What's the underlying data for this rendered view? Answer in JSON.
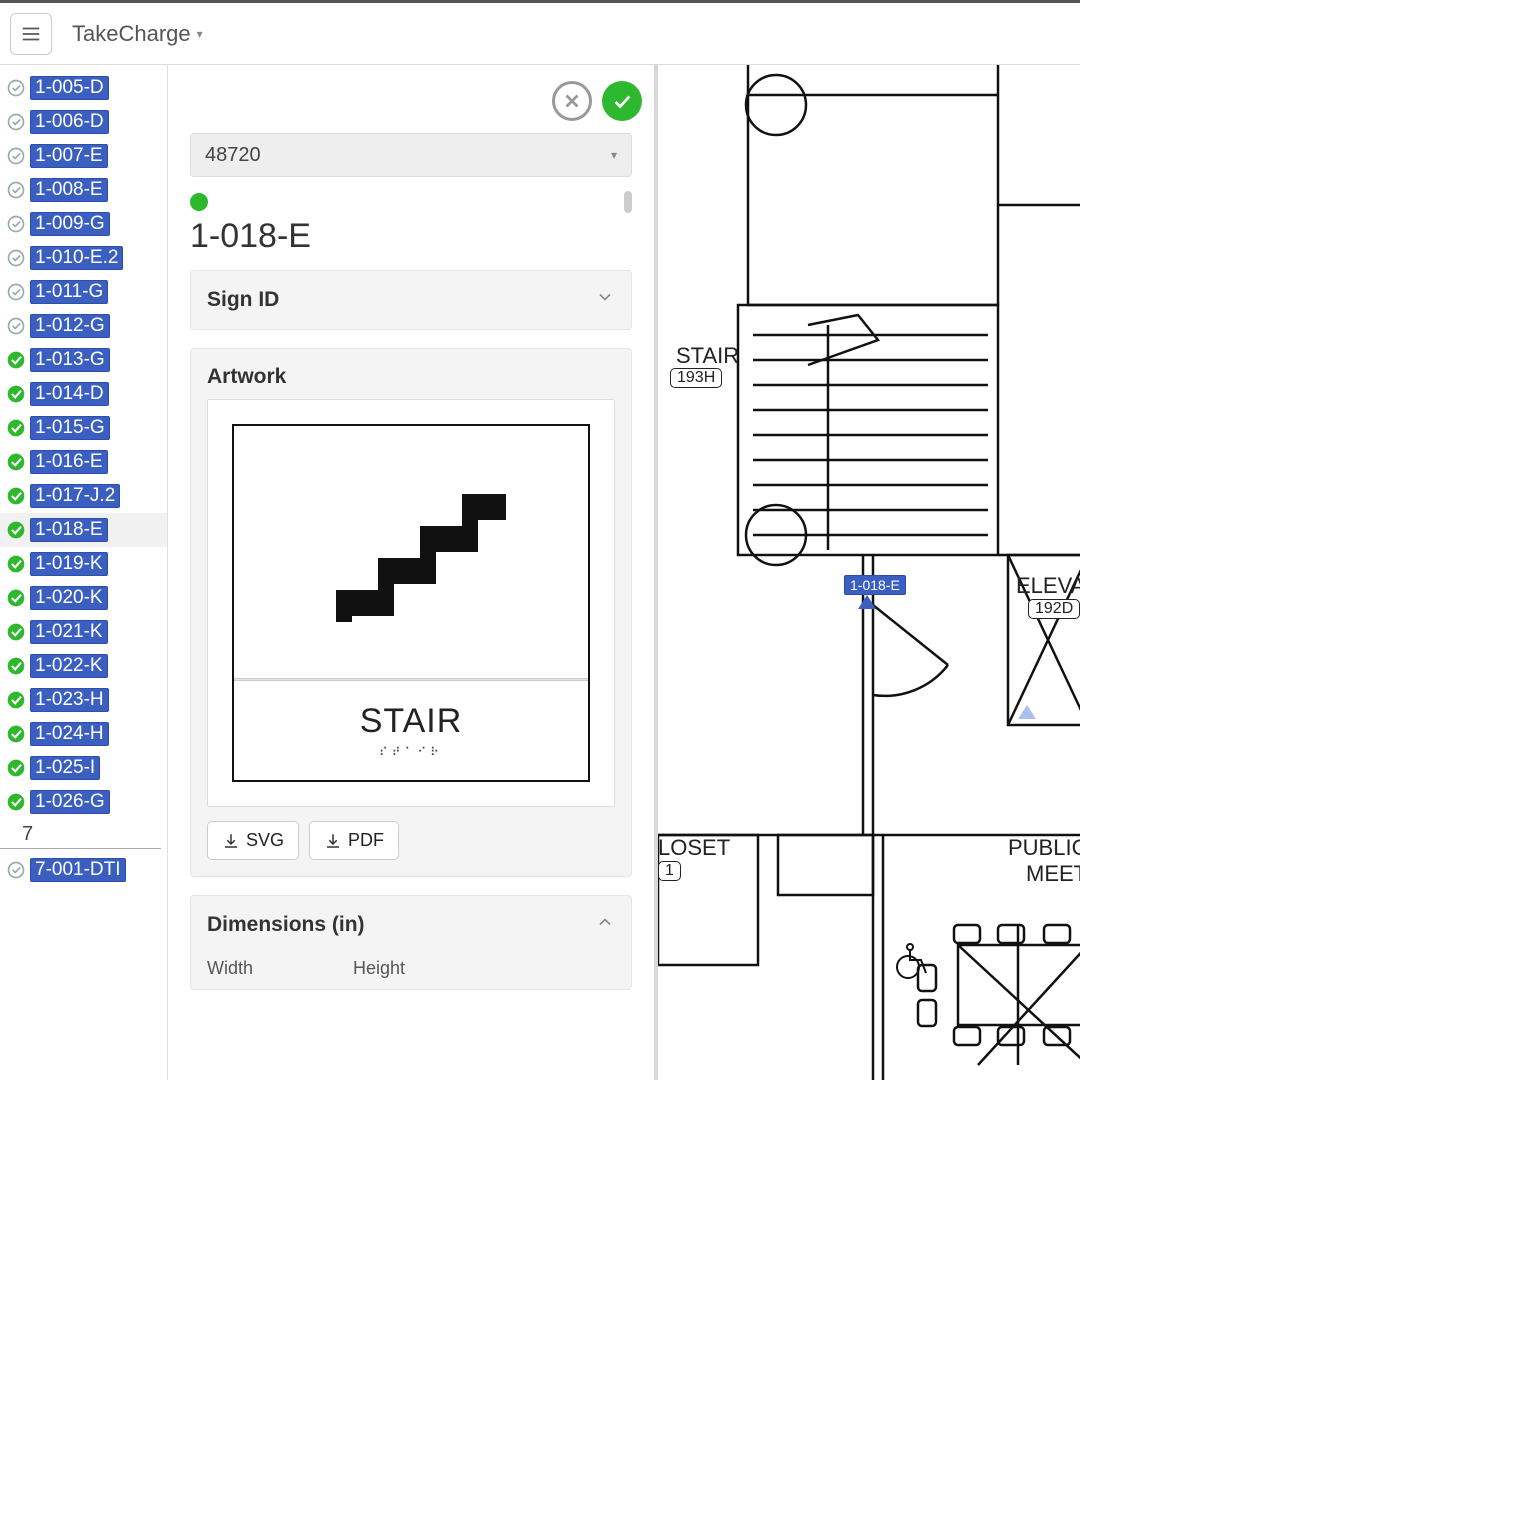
{
  "header": {
    "brand": "TakeCharge"
  },
  "sidebar": {
    "items": [
      {
        "id": "1-005-D",
        "status": "pending"
      },
      {
        "id": "1-006-D",
        "status": "pending"
      },
      {
        "id": "1-007-E",
        "status": "pending"
      },
      {
        "id": "1-008-E",
        "status": "pending"
      },
      {
        "id": "1-009-G",
        "status": "pending"
      },
      {
        "id": "1-010-E.2",
        "status": "pending"
      },
      {
        "id": "1-011-G",
        "status": "pending"
      },
      {
        "id": "1-012-G",
        "status": "pending"
      },
      {
        "id": "1-013-G",
        "status": "done"
      },
      {
        "id": "1-014-D",
        "status": "done"
      },
      {
        "id": "1-015-G",
        "status": "done"
      },
      {
        "id": "1-016-E",
        "status": "done"
      },
      {
        "id": "1-017-J.2",
        "status": "done"
      },
      {
        "id": "1-018-E",
        "status": "done",
        "selected": true
      },
      {
        "id": "1-019-K",
        "status": "done"
      },
      {
        "id": "1-020-K",
        "status": "done"
      },
      {
        "id": "1-021-K",
        "status": "done"
      },
      {
        "id": "1-022-K",
        "status": "done"
      },
      {
        "id": "1-023-H",
        "status": "done"
      },
      {
        "id": "1-024-H",
        "status": "done"
      },
      {
        "id": "1-025-I",
        "status": "done"
      },
      {
        "id": "1-026-G",
        "status": "done"
      }
    ],
    "group_label": "7",
    "group_items": [
      {
        "id": "7-001-DTI",
        "status": "pending"
      }
    ]
  },
  "detail": {
    "select_value": "48720",
    "title": "1-018-E",
    "sign_id_header": "Sign ID",
    "artwork_header": "Artwork",
    "artwork_label": "STAIR",
    "braille": "⠎⠞⠁⠊⠗",
    "svg_btn": "SVG",
    "pdf_btn": "PDF",
    "dimensions_header": "Dimensions (in)",
    "width_label": "Width",
    "height_label": "Height"
  },
  "plan": {
    "stair_label": "STAIR",
    "stair_code": "193H",
    "closet_label": "LOSET",
    "closet_code": "1",
    "elev_label": "ELEVAT",
    "elev_code": "192D",
    "public_label_1": "PUBLIC",
    "public_label_2": "MEET",
    "marker_tag": "1-018-E"
  }
}
